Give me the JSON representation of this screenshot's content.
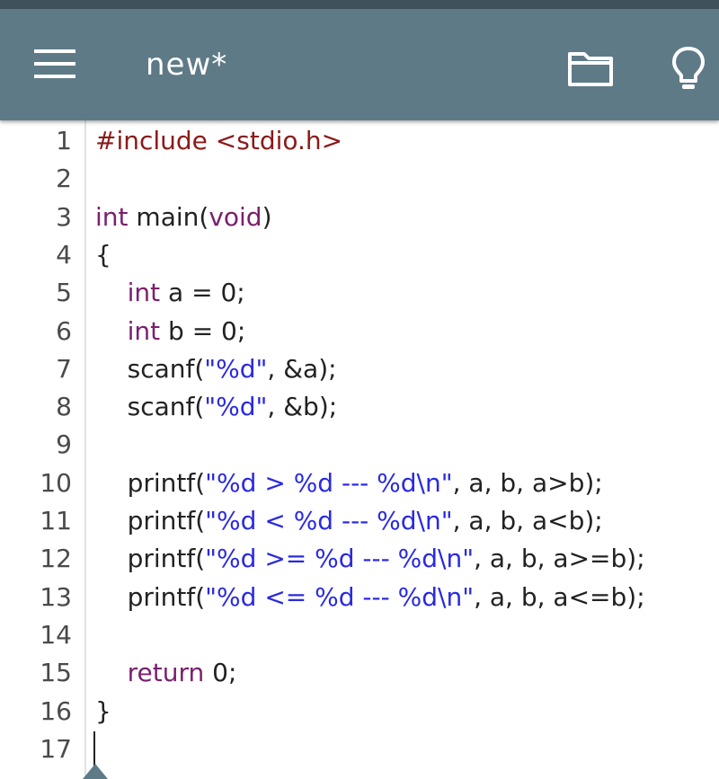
{
  "app": {
    "title": "new*",
    "icons": {
      "menu": "hamburger-menu-icon",
      "open": "folder-icon",
      "tips": "lightbulb-icon"
    },
    "colors": {
      "toolbar": "#5f7a87",
      "status_strip": "#3f525c",
      "preprocessor": "#8b1a1a",
      "keyword": "#7a1f6e",
      "string": "#2a2ae0",
      "plain": "#222222",
      "gutter_text": "#4a4a4a"
    }
  },
  "editor": {
    "lines": [
      {
        "n": "1",
        "tokens": [
          {
            "t": "#include <stdio.h>",
            "c": "preprocessor"
          }
        ]
      },
      {
        "n": "2",
        "tokens": []
      },
      {
        "n": "3",
        "tokens": [
          {
            "t": "int",
            "c": "keyword"
          },
          {
            "t": " main(",
            "c": "plain"
          },
          {
            "t": "void",
            "c": "keyword"
          },
          {
            "t": ")",
            "c": "plain"
          }
        ]
      },
      {
        "n": "4",
        "tokens": [
          {
            "t": "{",
            "c": "plain"
          }
        ]
      },
      {
        "n": "5",
        "tokens": [
          {
            "t": "    ",
            "c": "plain"
          },
          {
            "t": "int",
            "c": "keyword"
          },
          {
            "t": " a = 0;",
            "c": "plain"
          }
        ]
      },
      {
        "n": "6",
        "tokens": [
          {
            "t": "    ",
            "c": "plain"
          },
          {
            "t": "int",
            "c": "keyword"
          },
          {
            "t": " b = 0;",
            "c": "plain"
          }
        ]
      },
      {
        "n": "7",
        "tokens": [
          {
            "t": "    scanf(",
            "c": "plain"
          },
          {
            "t": "\"%d\"",
            "c": "string"
          },
          {
            "t": ", &a);",
            "c": "plain"
          }
        ]
      },
      {
        "n": "8",
        "tokens": [
          {
            "t": "    scanf(",
            "c": "plain"
          },
          {
            "t": "\"%d\"",
            "c": "string"
          },
          {
            "t": ", &b);",
            "c": "plain"
          }
        ]
      },
      {
        "n": "9",
        "tokens": []
      },
      {
        "n": "10",
        "tokens": [
          {
            "t": "    printf(",
            "c": "plain"
          },
          {
            "t": "\"%d > %d --- %d\\n\"",
            "c": "string"
          },
          {
            "t": ", a, b, a>b);",
            "c": "plain"
          }
        ]
      },
      {
        "n": "11",
        "tokens": [
          {
            "t": "    printf(",
            "c": "plain"
          },
          {
            "t": "\"%d < %d --- %d\\n\"",
            "c": "string"
          },
          {
            "t": ", a, b, a<b);",
            "c": "plain"
          }
        ]
      },
      {
        "n": "12",
        "tokens": [
          {
            "t": "    printf(",
            "c": "plain"
          },
          {
            "t": "\"%d >= %d --- %d\\n\"",
            "c": "string"
          },
          {
            "t": ", a, b, a>=b);",
            "c": "plain"
          }
        ]
      },
      {
        "n": "13",
        "tokens": [
          {
            "t": "    printf(",
            "c": "plain"
          },
          {
            "t": "\"%d <= %d --- %d\\n\"",
            "c": "string"
          },
          {
            "t": ", a, b, a<=b);",
            "c": "plain"
          }
        ]
      },
      {
        "n": "14",
        "tokens": []
      },
      {
        "n": "15",
        "tokens": [
          {
            "t": "    ",
            "c": "plain"
          },
          {
            "t": "return",
            "c": "keyword"
          },
          {
            "t": " 0;",
            "c": "plain"
          }
        ]
      },
      {
        "n": "16",
        "tokens": [
          {
            "t": "}",
            "c": "plain"
          }
        ]
      },
      {
        "n": "17",
        "tokens": []
      }
    ]
  }
}
